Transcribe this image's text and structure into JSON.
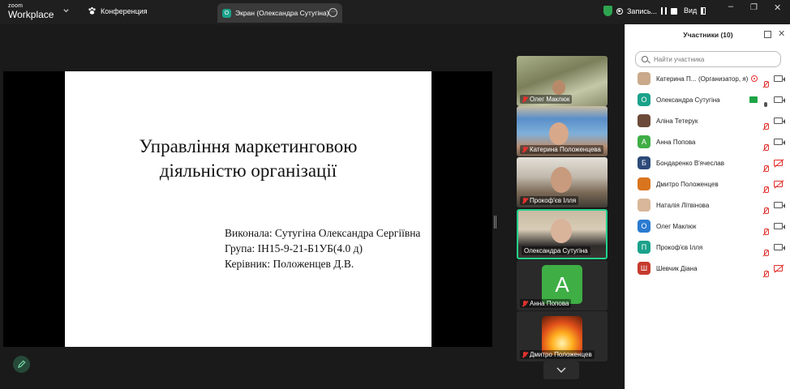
{
  "app": {
    "logo_small": "zoom",
    "logo_big": "Workplace"
  },
  "titlebar": {
    "conference": "Конференция",
    "screen_tab": "Экран (Олександра Сутугіна)",
    "recording": "Запись...",
    "view": "Вид"
  },
  "slide": {
    "title_line1": "Управління маркетинговою",
    "title_line2": "діяльністю організації",
    "author": "Виконала: Сутугіна Олександра Сергіївна",
    "group": "Група: ІН15-9-21-Б1УБ(4.0 д)",
    "supervisor": "Керівник: Положенцев Д.В."
  },
  "videos": [
    {
      "name": "Олег Маклюк"
    },
    {
      "name": "Катерина Положенцева"
    },
    {
      "name": "Прокоф'єв Ілля"
    },
    {
      "name": "Олександра Сутугіна"
    },
    {
      "name": "Анна Попова",
      "initial": "А"
    },
    {
      "name": "Дмитро Положенцев"
    }
  ],
  "panel": {
    "title": "Участники (10)",
    "search_placeholder": "Найти участника",
    "participants": [
      {
        "name": "Катерина П...",
        "role": "(Организатор, я)",
        "color": "#c9a98a",
        "initial": ""
      },
      {
        "name": "Олександра Сутугіна",
        "color": "#1aa28a",
        "initial": "О"
      },
      {
        "name": "Аліна Тетерук",
        "color": "#6b4a3a",
        "initial": ""
      },
      {
        "name": "Анна Попова",
        "color": "#3fae45",
        "initial": "А"
      },
      {
        "name": "Бондаренко В'ячеслав",
        "color": "#2d4a7a",
        "initial": "Б"
      },
      {
        "name": "Дмитро Положенцев",
        "color": "#d9751e",
        "initial": ""
      },
      {
        "name": "Наталія Літвінова",
        "color": "#d8b79a",
        "initial": ""
      },
      {
        "name": "Олег Маклюк",
        "color": "#2b7bd0",
        "initial": "О"
      },
      {
        "name": "Прокоф'єв Ілля",
        "color": "#1aa28a",
        "initial": "П"
      },
      {
        "name": "Шевчик Діана",
        "color": "#c63a2e",
        "initial": "Ш"
      }
    ]
  }
}
